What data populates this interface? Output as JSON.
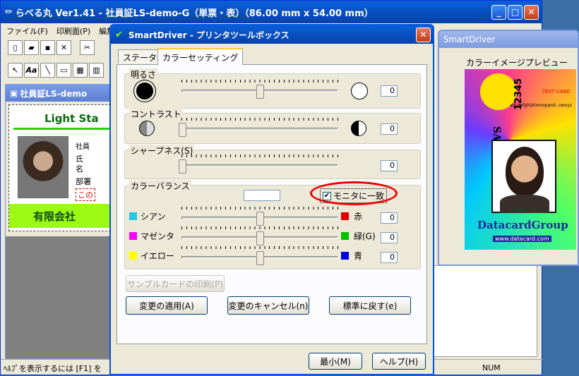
{
  "app": {
    "title": "らべる丸 Ver1.41 - 社員証LS-demo-G（単票・表）（86.00 mm x 54.00 mm）",
    "menus": [
      "ファイル(F)",
      "印刷面(P)",
      "編集"
    ],
    "status_text": "ﾍﾙﾌﾟを表示するには [F1] を",
    "num_indicator": "NUM"
  },
  "doc_window": {
    "title": "社員証LS-demo",
    "card": {
      "header": "Light Sta",
      "company": "有限会社",
      "text_fragments": [
        "社員",
        "氏",
        "名",
        "部署",
        "この"
      ]
    }
  },
  "dialog": {
    "title": "SmartDriver - プリンタツールボックス",
    "tabs": [
      "ステータス",
      "カラーセッティング"
    ],
    "brightness": {
      "label": "明るさ",
      "value": "0",
      "level": 0.5
    },
    "contrast": {
      "label": "コントラスト",
      "value": "0",
      "level": 0.0
    },
    "sharpness": {
      "label": "シャープネス(S)",
      "value": "0",
      "level": 0.0
    },
    "color_balance": {
      "label": "カラーバランス",
      "monitor_checkbox": "モニタに一致",
      "monitor_checked": true,
      "rows": [
        {
          "left": "シアン",
          "right": "赤",
          "value": "0",
          "left_color": "#29c5e6",
          "right_color": "#e00000",
          "level": 0.5
        },
        {
          "left": "マゼンタ",
          "right": "緑(G)",
          "value": "0",
          "left_color": "#ff00ff",
          "right_color": "#00c000",
          "level": 0.5
        },
        {
          "left": "イエロー",
          "right": "青",
          "value": "0",
          "left_color": "#ffff00",
          "right_color": "#0000e0",
          "level": 0.5
        }
      ]
    },
    "print_sample": "サンプルカードの印刷(P)",
    "apply": "変更の適用(A)",
    "cancel_changes": "変更のキャンセル(n)",
    "reset": "標準に戻す(e)",
    "minimize": "最小(M)",
    "help": "ヘルプ(H)"
  },
  "preview": {
    "title": "SmartDriver",
    "heading": "カラーイメージプレビュー",
    "card": {
      "sample_text": "SAMPLE CARD",
      "test_card": "TEST CARD",
      "numbers": "12345",
      "alphabet": "abcdefghijklmnopqrst..vwxyz",
      "brand": "DatacardGroup",
      "url": "www.datacard.com"
    }
  }
}
